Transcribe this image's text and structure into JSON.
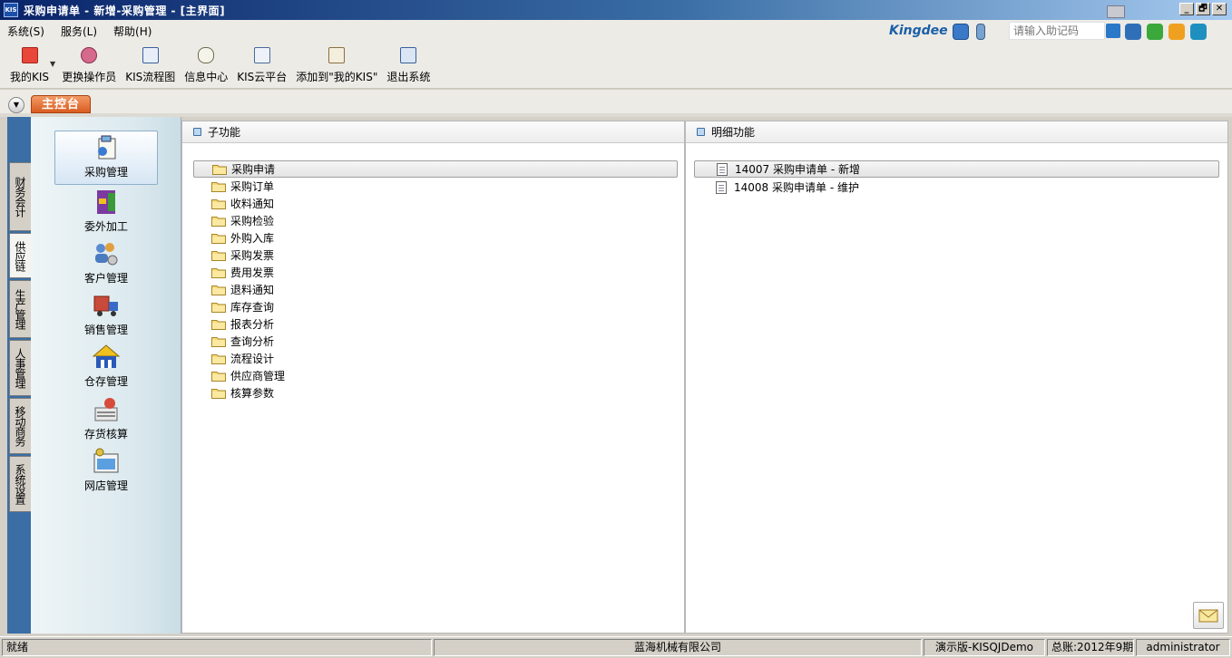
{
  "window": {
    "title": "采购申请单 - 新增-采购管理 - [主界面]",
    "app_badge": "KIS",
    "controls": [
      "_",
      "🗗",
      "✕"
    ]
  },
  "menubar": [
    "系统(S)",
    "服务(L)",
    "帮助(H)"
  ],
  "brand": "Kingdee",
  "search_placeholder": "请输入助记码",
  "toolbar": [
    {
      "label": "我的KIS",
      "icon": "star-icon",
      "has_dropdown": true
    },
    {
      "label": "更换操作员",
      "icon": "users-icon"
    },
    {
      "label": "KIS流程图",
      "icon": "flowchart-icon"
    },
    {
      "label": "信息中心",
      "icon": "message-icon"
    },
    {
      "label": "KIS云平台",
      "icon": "cloud-icon"
    },
    {
      "label": "添加到\"我的KIS\"",
      "icon": "add-favorite-icon"
    },
    {
      "label": "退出系统",
      "icon": "exit-icon"
    }
  ],
  "main_tab": "主控台",
  "side_tabs": [
    "财务会计",
    "供应链",
    "生产管理",
    "人事管理",
    "移动商务",
    "系统设置"
  ],
  "active_side_tab": 1,
  "modules": [
    {
      "label": "采购管理",
      "icon": "purchase-icon"
    },
    {
      "label": "委外加工",
      "icon": "outsource-icon"
    },
    {
      "label": "客户管理",
      "icon": "customer-icon"
    },
    {
      "label": "销售管理",
      "icon": "sales-icon"
    },
    {
      "label": "仓存管理",
      "icon": "warehouse-icon"
    },
    {
      "label": "存货核算",
      "icon": "inventory-icon"
    },
    {
      "label": "网店管理",
      "icon": "webshop-icon"
    }
  ],
  "subfunctions": {
    "header": "子功能",
    "items": [
      "采购申请",
      "采购订单",
      "收料通知",
      "采购检验",
      "外购入库",
      "采购发票",
      "费用发票",
      "退料通知",
      "库存查询",
      "报表分析",
      "查询分析",
      "流程设计",
      "供应商管理",
      "核算参数"
    ],
    "selected": 0
  },
  "details": {
    "header": "明细功能",
    "items": [
      {
        "code": "14007",
        "name": "采购申请单 - 新增"
      },
      {
        "code": "14008",
        "name": "采购申请单 - 维护"
      }
    ]
  },
  "status": {
    "ready": "就绪",
    "company": "蓝海机械有限公司",
    "edition": "演示版-KISQJDemo",
    "ledger": "总账:2012年9期",
    "user": "administrator"
  },
  "colors": {
    "title_start": "#0a246a",
    "side_tab_bar": "#3a6ea5",
    "main_tab": "#e06a2c",
    "brand": "#1a5fa8"
  }
}
